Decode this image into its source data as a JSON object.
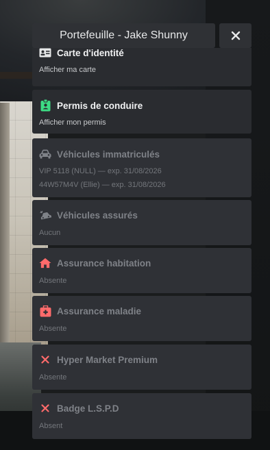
{
  "header": {
    "title": "Portefeuille - Jake Shunny"
  },
  "close": {
    "icon": "close-icon"
  },
  "cards": [
    {
      "title": "Carte d'identité",
      "lines": [
        "Afficher ma carte"
      ],
      "icon": "id-card-icon",
      "active": true
    },
    {
      "title": "Permis de conduire",
      "lines": [
        "Afficher mon permis"
      ],
      "icon": "driver-license-icon",
      "active": true,
      "icon_color": "#3ddc84"
    },
    {
      "title": "Véhicules immatriculés",
      "lines": [
        "VIP 5118 (NULL) — exp. 31/08/2026",
        "44W57M4V (Ellie) — exp. 31/08/2026"
      ],
      "icon": "car-icon",
      "active": false
    },
    {
      "title": "Véhicules assurés",
      "lines": [
        "Aucun"
      ],
      "icon": "car-crash-icon",
      "active": false
    },
    {
      "title": "Assurance habitation",
      "lines": [
        "Absente"
      ],
      "icon": "house-icon",
      "active": false,
      "icon_color": "#ff6b6b"
    },
    {
      "title": "Assurance maladie",
      "lines": [
        "Absente"
      ],
      "icon": "medkit-icon",
      "active": false,
      "icon_color": "#ff6b6b"
    },
    {
      "title": "Hyper Market Premium",
      "lines": [
        "Absente"
      ],
      "icon": "x-icon",
      "active": false,
      "icon_color": "#ff6b6b"
    },
    {
      "title": "Badge L.S.P.D",
      "lines": [
        "Absent"
      ],
      "icon": "x-icon",
      "active": false,
      "icon_color": "#ff6b6b"
    }
  ]
}
